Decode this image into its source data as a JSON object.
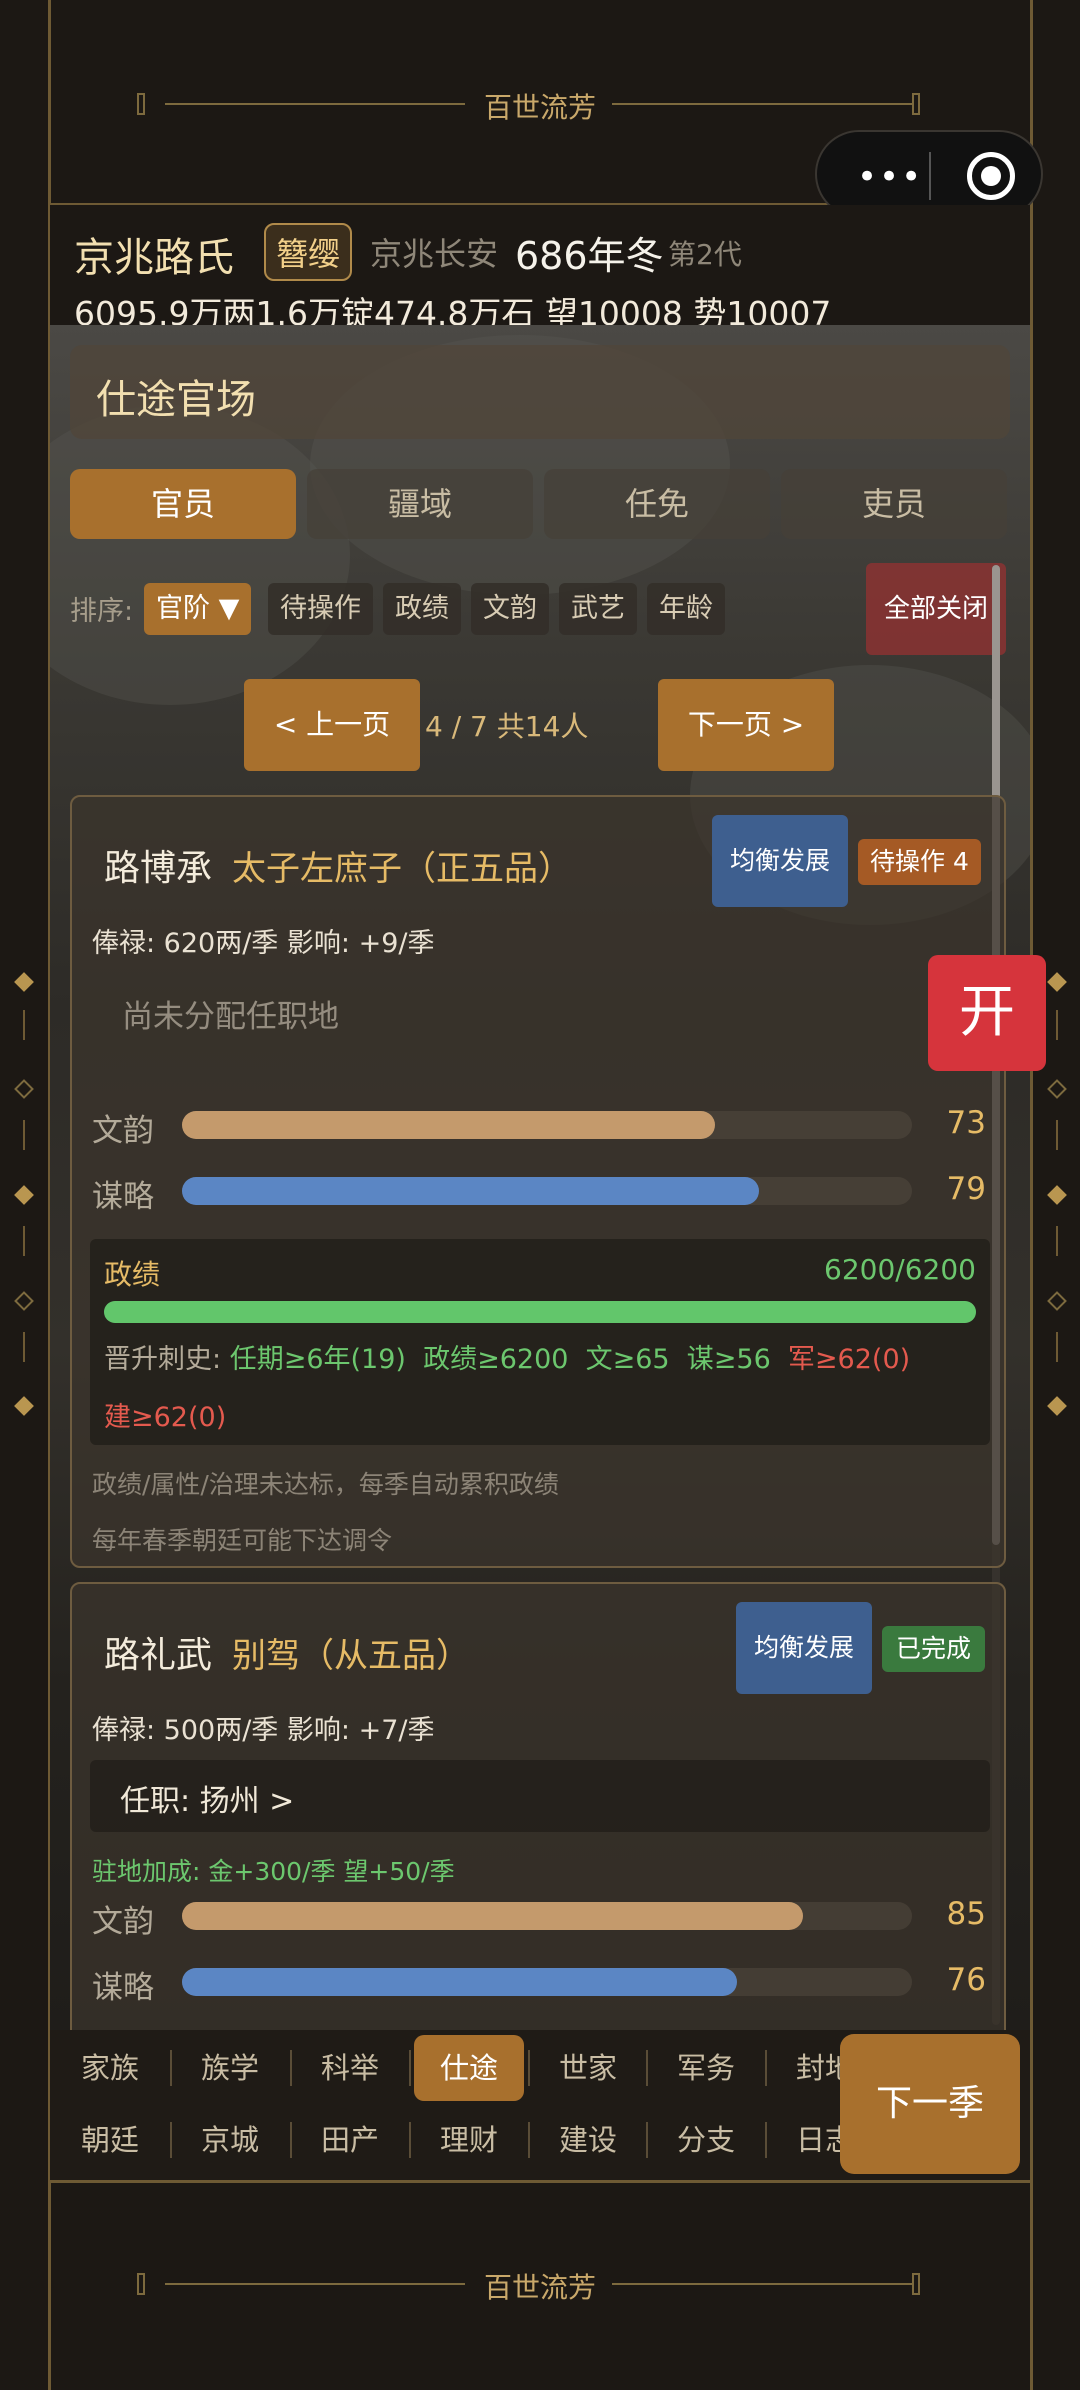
{
  "app": {
    "brand": "百世流芳"
  },
  "header": {
    "clan_name": "京兆路氏",
    "rank_badge": "簪缨",
    "place": "京兆长安",
    "year": "686年冬",
    "generation": "第2代",
    "resources": "6095.9万两1.6万锭474.8万石  望10008 势10007"
  },
  "section": {
    "title": "仕途官场"
  },
  "tabs": [
    "官员",
    "疆域",
    "任免",
    "吏员"
  ],
  "sort": {
    "label": "排序:",
    "options": [
      "官阶 ▼",
      "待操作",
      "政绩",
      "文韵",
      "武艺",
      "年龄"
    ],
    "close_all": "全部关闭"
  },
  "pager": {
    "prev": "< 上一页",
    "info": "4 / 7  共14人",
    "next": "下一页 >"
  },
  "officials": [
    {
      "name": "路博承",
      "title": "太子左庶子（正五品）",
      "plan": "均衡发展",
      "status": "待操作 4",
      "salary": "俸禄: 620两/季   影响: +9/季",
      "post": "尚未分配任职地",
      "stats": [
        {
          "label": "文韵",
          "value": 73
        },
        {
          "label": "谋略",
          "value": 79
        }
      ],
      "performance": {
        "label": "政绩",
        "value": "6200/6200",
        "fraction": 1.0
      },
      "promotion": {
        "label": "晋升刺史:",
        "reqs": [
          {
            "text": "任期≥6年(19)",
            "met": true
          },
          {
            "text": "政绩≥6200",
            "met": true
          },
          {
            "text": "文≥65",
            "met": true
          },
          {
            "text": "谋≥56",
            "met": true
          },
          {
            "text": "军≥62(0)",
            "met": false
          },
          {
            "text": "建≥62(0)",
            "met": false
          }
        ]
      },
      "notes": [
        "政绩/属性/治理未达标，每季自动累积政绩",
        "每年春季朝廷可能下达调令"
      ]
    },
    {
      "name": "路礼武",
      "title": "别驾（从五品）",
      "plan": "均衡发展",
      "status": "已完成",
      "salary": "俸禄: 500两/季   影响: +7/季",
      "post": "任职: 扬州  >",
      "bonus": "驻地加成: 金+300/季  望+50/季",
      "stats": [
        {
          "label": "文韵",
          "value": 85
        },
        {
          "label": "谋略",
          "value": 76
        }
      ]
    }
  ],
  "floating": {
    "open_label": "开"
  },
  "nav": {
    "row1": [
      "家族",
      "族学",
      "科举",
      "仕途",
      "世家",
      "军务",
      "封地"
    ],
    "row2": [
      "朝廷",
      "京城",
      "田产",
      "理财",
      "建设",
      "分支",
      "日志"
    ],
    "active": "仕途",
    "next_season": "下一季"
  },
  "colors": {
    "accent": "#a8702d",
    "gold": "#e6bb66",
    "green": "#62c66b",
    "red": "#e45a4e",
    "blue_bar": "#5b86c4",
    "tan_bar": "#c49a6c"
  },
  "icons": {
    "menu": "more-dots-icon",
    "close": "target-circle-icon"
  }
}
